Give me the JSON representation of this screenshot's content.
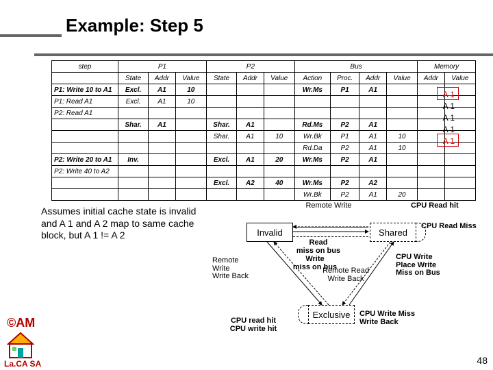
{
  "title": "Example: Step 5",
  "table": {
    "groups": [
      "step",
      "P1",
      "P2",
      "Bus",
      "Memory"
    ],
    "sub": {
      "p1": [
        "State",
        "Addr",
        "Value"
      ],
      "p2": [
        "State",
        "Addr",
        "Value"
      ],
      "bus": [
        "Action",
        "Proc.",
        "Addr",
        "Value"
      ],
      "mem": [
        "Addr",
        "Value"
      ]
    },
    "rows": [
      {
        "step": "P1: Write 10 to A1",
        "p1s": "Excl.",
        "p1a": "A1",
        "p1v": "10",
        "bus_a": "Wr.Ms",
        "bus_p": "P1",
        "bus_ad": "A1"
      },
      {
        "step": "P1: Read A1",
        "p1s": "Excl.",
        "p1a": "A1",
        "p1v": "10"
      },
      {
        "step": "P2: Read A1"
      },
      {
        "p1s": "Shar.",
        "p1a": "A1",
        "p2s": "Shar.",
        "p2a": "A1",
        "bus_a": "Rd.Ms",
        "bus_p": "P2",
        "bus_ad": "A1"
      },
      {
        "p2s": "Shar.",
        "p2a": "A1",
        "p2v": "10",
        "bus_a": "Wr.Bk",
        "bus_p": "P1",
        "bus_ad": "A1",
        "bus_v": "10"
      },
      {
        "bus_a": "Rd.Da",
        "bus_p": "P2",
        "bus_ad": "A1",
        "bus_v": "10"
      },
      {
        "step": "P2: Write 20 to A1",
        "p1s": "Inv.",
        "p2s": "Excl.",
        "p2a": "A1",
        "p2v": "20",
        "bus_a": "Wr.Ms",
        "bus_p": "P2",
        "bus_ad": "A1"
      },
      {
        "step": "P2: Write 40 to A2"
      },
      {
        "p2s": "Excl.",
        "p2a": "A2",
        "p2v": "40",
        "bus_a": "Wr.Ms",
        "bus_p": "P2",
        "bus_ad": "A2"
      },
      {
        "bus_a": "Wr.Bk",
        "bus_p": "P2",
        "bus_ad": "A1",
        "bus_v": "20"
      }
    ]
  },
  "anno": {
    "lines": [
      "A 1",
      "A 1",
      "A 1",
      "A 1",
      "A 1"
    ]
  },
  "assume": "Assumes initial cache state is invalid and A 1 and A 2 map to same cache block, but A 1 != A 2",
  "diagram": {
    "invalid": "Invalid",
    "shared": "Shared",
    "exclusive": "Exclusive",
    "remote_write_top": "Remote Write",
    "cpu_read_hit": "CPU Read hit",
    "cpu_read_miss": "CPU Read Miss",
    "read_miss_bus": "Read miss on bus",
    "write_miss_bus": "Write miss on bus",
    "remote_write_wb": "Remote Write Write Back",
    "remote_read_wb": "Remote Read Write Back",
    "cpu_write_place": "CPU Write Place Write Miss on Bus",
    "cpu_rh_wh": "CPU read hit CPU write hit",
    "cpu_wm_wb": "CPU Write Miss Write Back"
  },
  "am": "©AM",
  "lacasa": "La.CA SA",
  "page": "48"
}
